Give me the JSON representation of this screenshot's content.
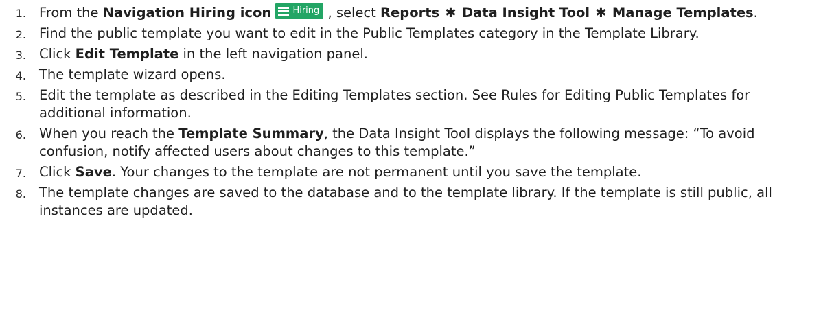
{
  "steps": [
    {
      "num": "1.",
      "t1": "From the ",
      "b1": "Navigation Hiring icon",
      "icon_label": "Hiring",
      "icon_name": "hamburger-menu-icon",
      "t2": " , select ",
      "b2": "Reports",
      "sep1": "✱",
      "b3": "Data Insight Tool",
      "sep2": "✱",
      "b4": "Manage Templates",
      "t3": "."
    },
    {
      "num": "2.",
      "text": "Find the public template you want to edit in the Public Templates category in the Template Library."
    },
    {
      "num": "3.",
      "t1": "Click ",
      "b1": "Edit Template",
      "t2": " in the left navigation panel."
    },
    {
      "num": "4.",
      "text": "The template wizard opens."
    },
    {
      "num": "5.",
      "text": "Edit the template as described in the Editing Templates section. See Rules for Editing Public Templates for additional information."
    },
    {
      "num": "6.",
      "t1": "When you reach the ",
      "b1": "Template Summary",
      "t2": ", the Data Insight Tool displays the following message: “To avoid confusion, notify affected users about changes to this template.”"
    },
    {
      "num": "7.",
      "t1": "Click ",
      "b1": "Save",
      "t2": ". Your changes to the template are not permanent until you save the template."
    },
    {
      "num": "8.",
      "text": "The template changes are saved to the database and to the template library. If the template is still public, all instances are updated."
    }
  ],
  "colors": {
    "hiring_icon_bg": "#23a565",
    "text": "#1f1f1f"
  }
}
